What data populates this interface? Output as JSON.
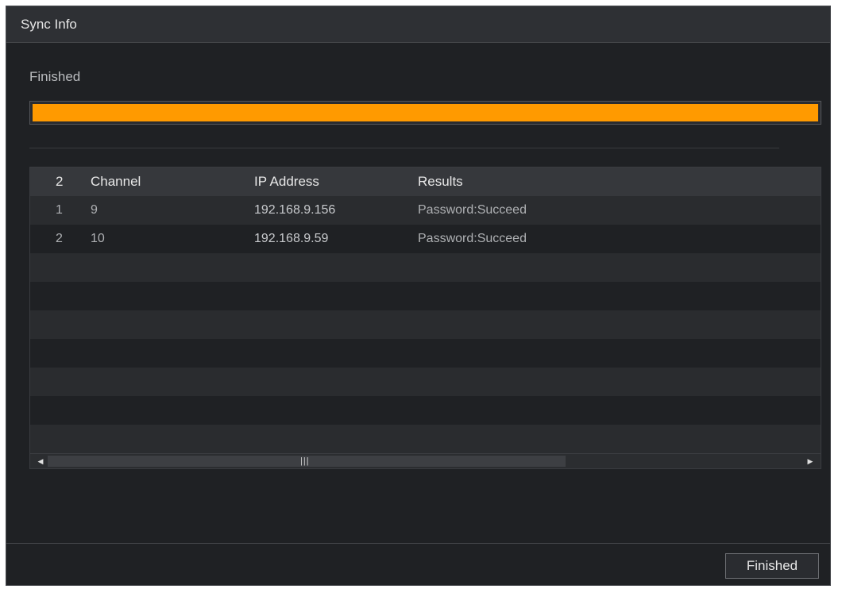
{
  "dialog": {
    "title": "Sync Info",
    "status_text": "Finished",
    "progress_fraction": 1.0,
    "progress_color": "#ff9a00"
  },
  "table": {
    "headers": {
      "count": "2",
      "channel": "Channel",
      "ip_address": "IP Address",
      "results": "Results"
    },
    "rows": [
      {
        "index": "1",
        "channel": "9",
        "ip": "192.168.9.156",
        "result": "Password:Succeed"
      },
      {
        "index": "2",
        "channel": "10",
        "ip": "192.168.9.59",
        "result": "Password:Succeed"
      }
    ],
    "empty_row_count": 8,
    "scrollbar": {
      "left_icon": "arrow-left-icon",
      "right_icon": "arrow-right-icon",
      "grip_icon": "grip-icon",
      "grip": "|||"
    }
  },
  "footer": {
    "finished_button_label": "Finished"
  }
}
